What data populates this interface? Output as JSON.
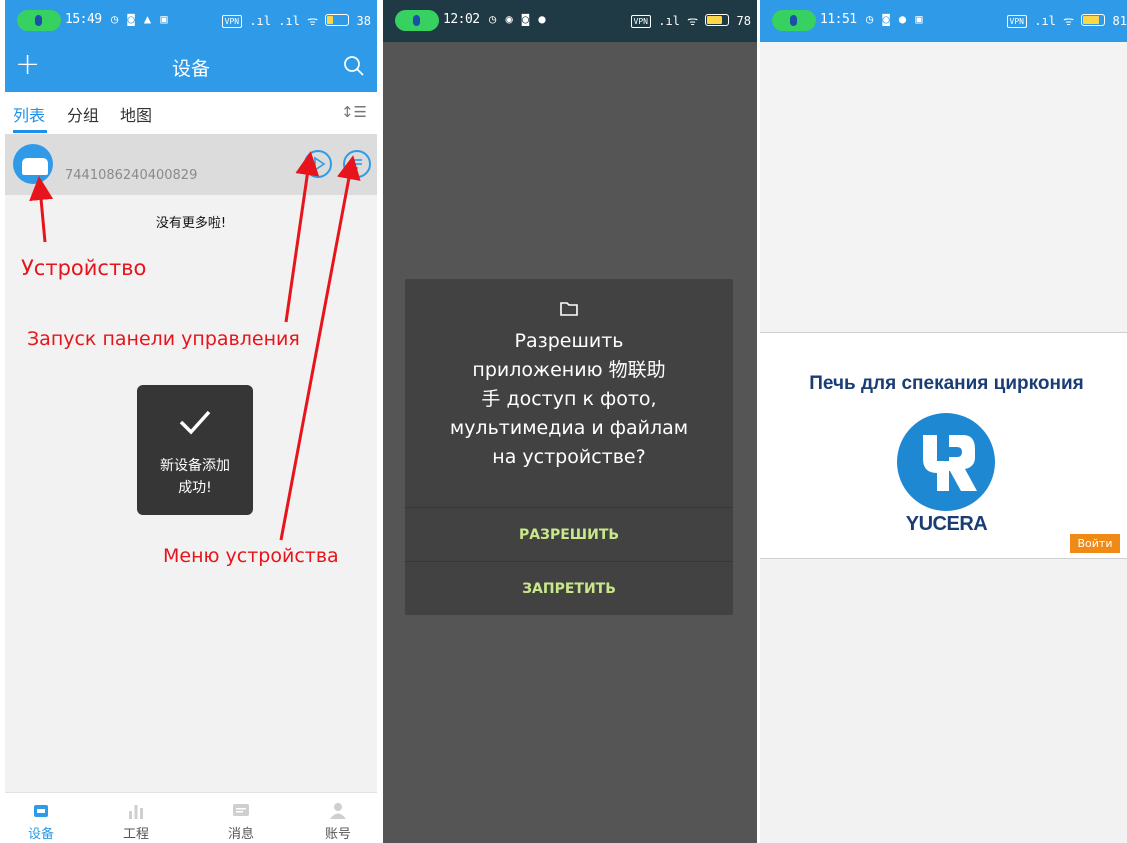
{
  "screen1": {
    "status": {
      "time": "15:49",
      "battery": "38"
    },
    "header": {
      "title": "设备"
    },
    "tabs": [
      "列表",
      "分组",
      "地图"
    ],
    "device": {
      "id": "7441086240400829"
    },
    "no_more": "没有更多啦!",
    "toast": {
      "line1": "新设备添加",
      "line2": "成功!"
    },
    "annotations": {
      "device": "Устройство",
      "control_panel": "Запуск панели управления",
      "device_menu": "Меню устройства"
    },
    "bottom_nav": [
      "设备",
      "工程",
      "消息",
      "账号"
    ],
    "colors": {
      "accent": "#2f9be8",
      "annotation": "#e8141b"
    }
  },
  "screen2": {
    "status": {
      "time": "12:02",
      "battery": "78"
    },
    "dialog": {
      "line1": "Разрешить",
      "line2": "приложению 物联助",
      "line3": "手 доступ к фото,",
      "line4": "мультимедиа и файлам",
      "line5": "на устройстве?",
      "allow": "РАЗРЕШИТЬ",
      "deny": "ЗАПРЕТИТЬ"
    }
  },
  "screen3": {
    "status": {
      "time": "11:51",
      "battery": "81"
    },
    "heading": "Печь для спекания циркония",
    "brand": "YUCERA",
    "login": "Войти",
    "colors": {
      "brand_blue": "#1e88d2",
      "login_orange": "#ef8a17"
    }
  }
}
